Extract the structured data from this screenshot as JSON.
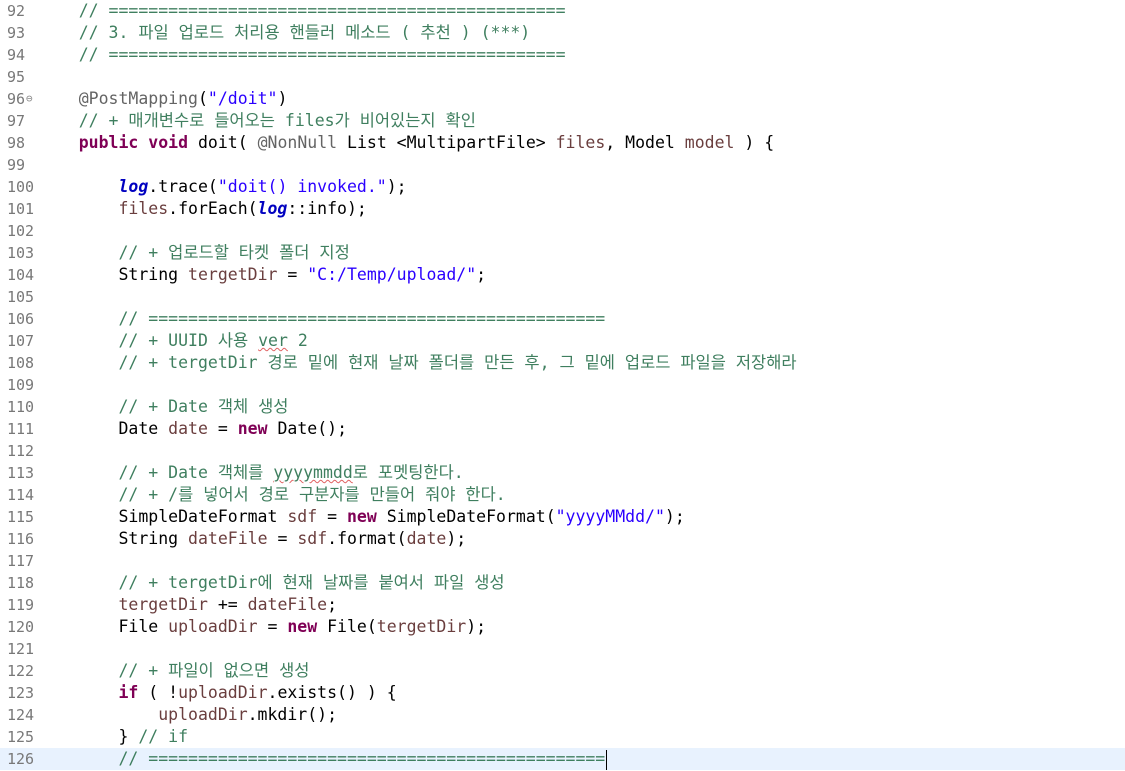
{
  "editor": {
    "current_line": "126",
    "colors": {
      "comment": "#3f7f5f",
      "keyword": "#7f0055",
      "annotation": "#646464",
      "string": "#2a00ff",
      "static_field": "#0000c0",
      "local_variable": "#6a3e3e",
      "line_number": "#787878",
      "current_line_bg": "#e8f2fe"
    },
    "lines": [
      {
        "num": "92",
        "indent": "    ",
        "tokens": [
          {
            "t": "// ==============================================",
            "c": "comment"
          }
        ]
      },
      {
        "num": "93",
        "indent": "    ",
        "tokens": [
          {
            "t": "// 3. 파일 업로드 처리용 핸들러 메소드 ( 추천 ) (***)",
            "c": "comment"
          }
        ]
      },
      {
        "num": "94",
        "indent": "    ",
        "tokens": [
          {
            "t": "// ==============================================",
            "c": "comment"
          }
        ]
      },
      {
        "num": "95",
        "indent": "",
        "tokens": []
      },
      {
        "num": "96",
        "fold": "⊖",
        "indent": "    ",
        "tokens": [
          {
            "t": "@PostMapping",
            "c": "ann"
          },
          {
            "t": "(",
            "c": "plain"
          },
          {
            "t": "\"/doit\"",
            "c": "str"
          },
          {
            "t": ")",
            "c": "plain"
          }
        ]
      },
      {
        "num": "97",
        "indent": "    ",
        "tokens": [
          {
            "t": "// + 매개변수로 들어오는 files가 비어있는지 확인",
            "c": "comment"
          }
        ]
      },
      {
        "num": "98",
        "indent": "    ",
        "tokens": [
          {
            "t": "public",
            "c": "kw"
          },
          {
            "t": " ",
            "c": "plain"
          },
          {
            "t": "void",
            "c": "kw"
          },
          {
            "t": " doit( ",
            "c": "plain"
          },
          {
            "t": "@NonNull",
            "c": "ann"
          },
          {
            "t": " List <MultipartFile> ",
            "c": "plain"
          },
          {
            "t": "files",
            "c": "var"
          },
          {
            "t": ", Model ",
            "c": "plain"
          },
          {
            "t": "model",
            "c": "var"
          },
          {
            "t": " ) {",
            "c": "plain"
          }
        ]
      },
      {
        "num": "99",
        "indent": "",
        "tokens": []
      },
      {
        "num": "100",
        "indent": "        ",
        "tokens": [
          {
            "t": "log",
            "c": "field"
          },
          {
            "t": ".trace(",
            "c": "plain"
          },
          {
            "t": "\"doit() invoked.\"",
            "c": "str"
          },
          {
            "t": ");",
            "c": "plain"
          }
        ]
      },
      {
        "num": "101",
        "indent": "        ",
        "tokens": [
          {
            "t": "files",
            "c": "var"
          },
          {
            "t": ".forEach(",
            "c": "plain"
          },
          {
            "t": "log",
            "c": "field"
          },
          {
            "t": "::info);",
            "c": "plain"
          }
        ]
      },
      {
        "num": "102",
        "indent": "",
        "tokens": []
      },
      {
        "num": "103",
        "indent": "        ",
        "tokens": [
          {
            "t": "// + 업로드할 타켓 폴더 지정",
            "c": "comment"
          }
        ]
      },
      {
        "num": "104",
        "indent": "        ",
        "tokens": [
          {
            "t": "String ",
            "c": "plain"
          },
          {
            "t": "tergetDir",
            "c": "var"
          },
          {
            "t": " = ",
            "c": "plain"
          },
          {
            "t": "\"C:/Temp/upload/\"",
            "c": "str"
          },
          {
            "t": ";",
            "c": "plain"
          }
        ]
      },
      {
        "num": "105",
        "indent": "",
        "tokens": []
      },
      {
        "num": "106",
        "indent": "        ",
        "tokens": [
          {
            "t": "// ==============================================",
            "c": "comment"
          }
        ]
      },
      {
        "num": "107",
        "indent": "        ",
        "tokens": [
          {
            "t": "// + UUID 사용 ",
            "c": "comment"
          },
          {
            "t": "ver",
            "c": "comment",
            "squiggle": true
          },
          {
            "t": " 2",
            "c": "comment"
          }
        ]
      },
      {
        "num": "108",
        "indent": "        ",
        "tokens": [
          {
            "t": "// + tergetDir 경로 밑에 현재 날짜 폴더를 만든 후, 그 밑에 업로드 파일을 저장해라",
            "c": "comment"
          }
        ]
      },
      {
        "num": "109",
        "indent": "",
        "tokens": []
      },
      {
        "num": "110",
        "indent": "        ",
        "tokens": [
          {
            "t": "// + Date 객체 생성",
            "c": "comment"
          }
        ]
      },
      {
        "num": "111",
        "indent": "        ",
        "tokens": [
          {
            "t": "Date ",
            "c": "plain"
          },
          {
            "t": "date",
            "c": "var"
          },
          {
            "t": " = ",
            "c": "plain"
          },
          {
            "t": "new",
            "c": "kw"
          },
          {
            "t": " Date();",
            "c": "plain"
          }
        ]
      },
      {
        "num": "112",
        "indent": "",
        "tokens": []
      },
      {
        "num": "113",
        "indent": "        ",
        "tokens": [
          {
            "t": "// + Date 객체를 ",
            "c": "comment"
          },
          {
            "t": "yyyymmdd",
            "c": "comment",
            "squiggle": true
          },
          {
            "t": "로 포멧팅한다.",
            "c": "comment"
          }
        ]
      },
      {
        "num": "114",
        "indent": "        ",
        "tokens": [
          {
            "t": "// + /를 넣어서 경로 구분자를 만들어 줘야 한다.",
            "c": "comment"
          }
        ]
      },
      {
        "num": "115",
        "indent": "        ",
        "tokens": [
          {
            "t": "SimpleDateFormat ",
            "c": "plain"
          },
          {
            "t": "sdf",
            "c": "var"
          },
          {
            "t": " = ",
            "c": "plain"
          },
          {
            "t": "new",
            "c": "kw"
          },
          {
            "t": " SimpleDateFormat(",
            "c": "plain"
          },
          {
            "t": "\"yyyyMMdd/\"",
            "c": "str"
          },
          {
            "t": ");",
            "c": "plain"
          }
        ]
      },
      {
        "num": "116",
        "indent": "        ",
        "tokens": [
          {
            "t": "String ",
            "c": "plain"
          },
          {
            "t": "dateFile",
            "c": "var"
          },
          {
            "t": " = ",
            "c": "plain"
          },
          {
            "t": "sdf",
            "c": "var"
          },
          {
            "t": ".format(",
            "c": "plain"
          },
          {
            "t": "date",
            "c": "var"
          },
          {
            "t": ");",
            "c": "plain"
          }
        ]
      },
      {
        "num": "117",
        "indent": "",
        "tokens": []
      },
      {
        "num": "118",
        "indent": "        ",
        "tokens": [
          {
            "t": "// + tergetDir에 현재 날짜를 붙여서 파일 생성",
            "c": "comment"
          }
        ]
      },
      {
        "num": "119",
        "indent": "        ",
        "tokens": [
          {
            "t": "tergetDir",
            "c": "var"
          },
          {
            "t": " += ",
            "c": "plain"
          },
          {
            "t": "dateFile",
            "c": "var"
          },
          {
            "t": ";",
            "c": "plain"
          }
        ]
      },
      {
        "num": "120",
        "indent": "        ",
        "tokens": [
          {
            "t": "File ",
            "c": "plain"
          },
          {
            "t": "uploadDir",
            "c": "var"
          },
          {
            "t": " = ",
            "c": "plain"
          },
          {
            "t": "new",
            "c": "kw"
          },
          {
            "t": " File(",
            "c": "plain"
          },
          {
            "t": "tergetDir",
            "c": "var"
          },
          {
            "t": ");",
            "c": "plain"
          }
        ]
      },
      {
        "num": "121",
        "indent": "",
        "tokens": []
      },
      {
        "num": "122",
        "indent": "        ",
        "tokens": [
          {
            "t": "// + 파일이 없으면 생성",
            "c": "comment"
          }
        ]
      },
      {
        "num": "123",
        "indent": "        ",
        "tokens": [
          {
            "t": "if",
            "c": "kw"
          },
          {
            "t": " ( !",
            "c": "plain"
          },
          {
            "t": "uploadDir",
            "c": "var"
          },
          {
            "t": ".exists() ) {",
            "c": "plain"
          }
        ]
      },
      {
        "num": "124",
        "indent": "            ",
        "tokens": [
          {
            "t": "uploadDir",
            "c": "var"
          },
          {
            "t": ".mkdir();",
            "c": "plain"
          }
        ]
      },
      {
        "num": "125",
        "indent": "        ",
        "tokens": [
          {
            "t": "} ",
            "c": "plain"
          },
          {
            "t": "// if",
            "c": "comment"
          }
        ]
      },
      {
        "num": "126",
        "indent": "        ",
        "tokens": [
          {
            "t": "// ==============================================",
            "c": "comment"
          }
        ],
        "caret": true
      }
    ]
  }
}
